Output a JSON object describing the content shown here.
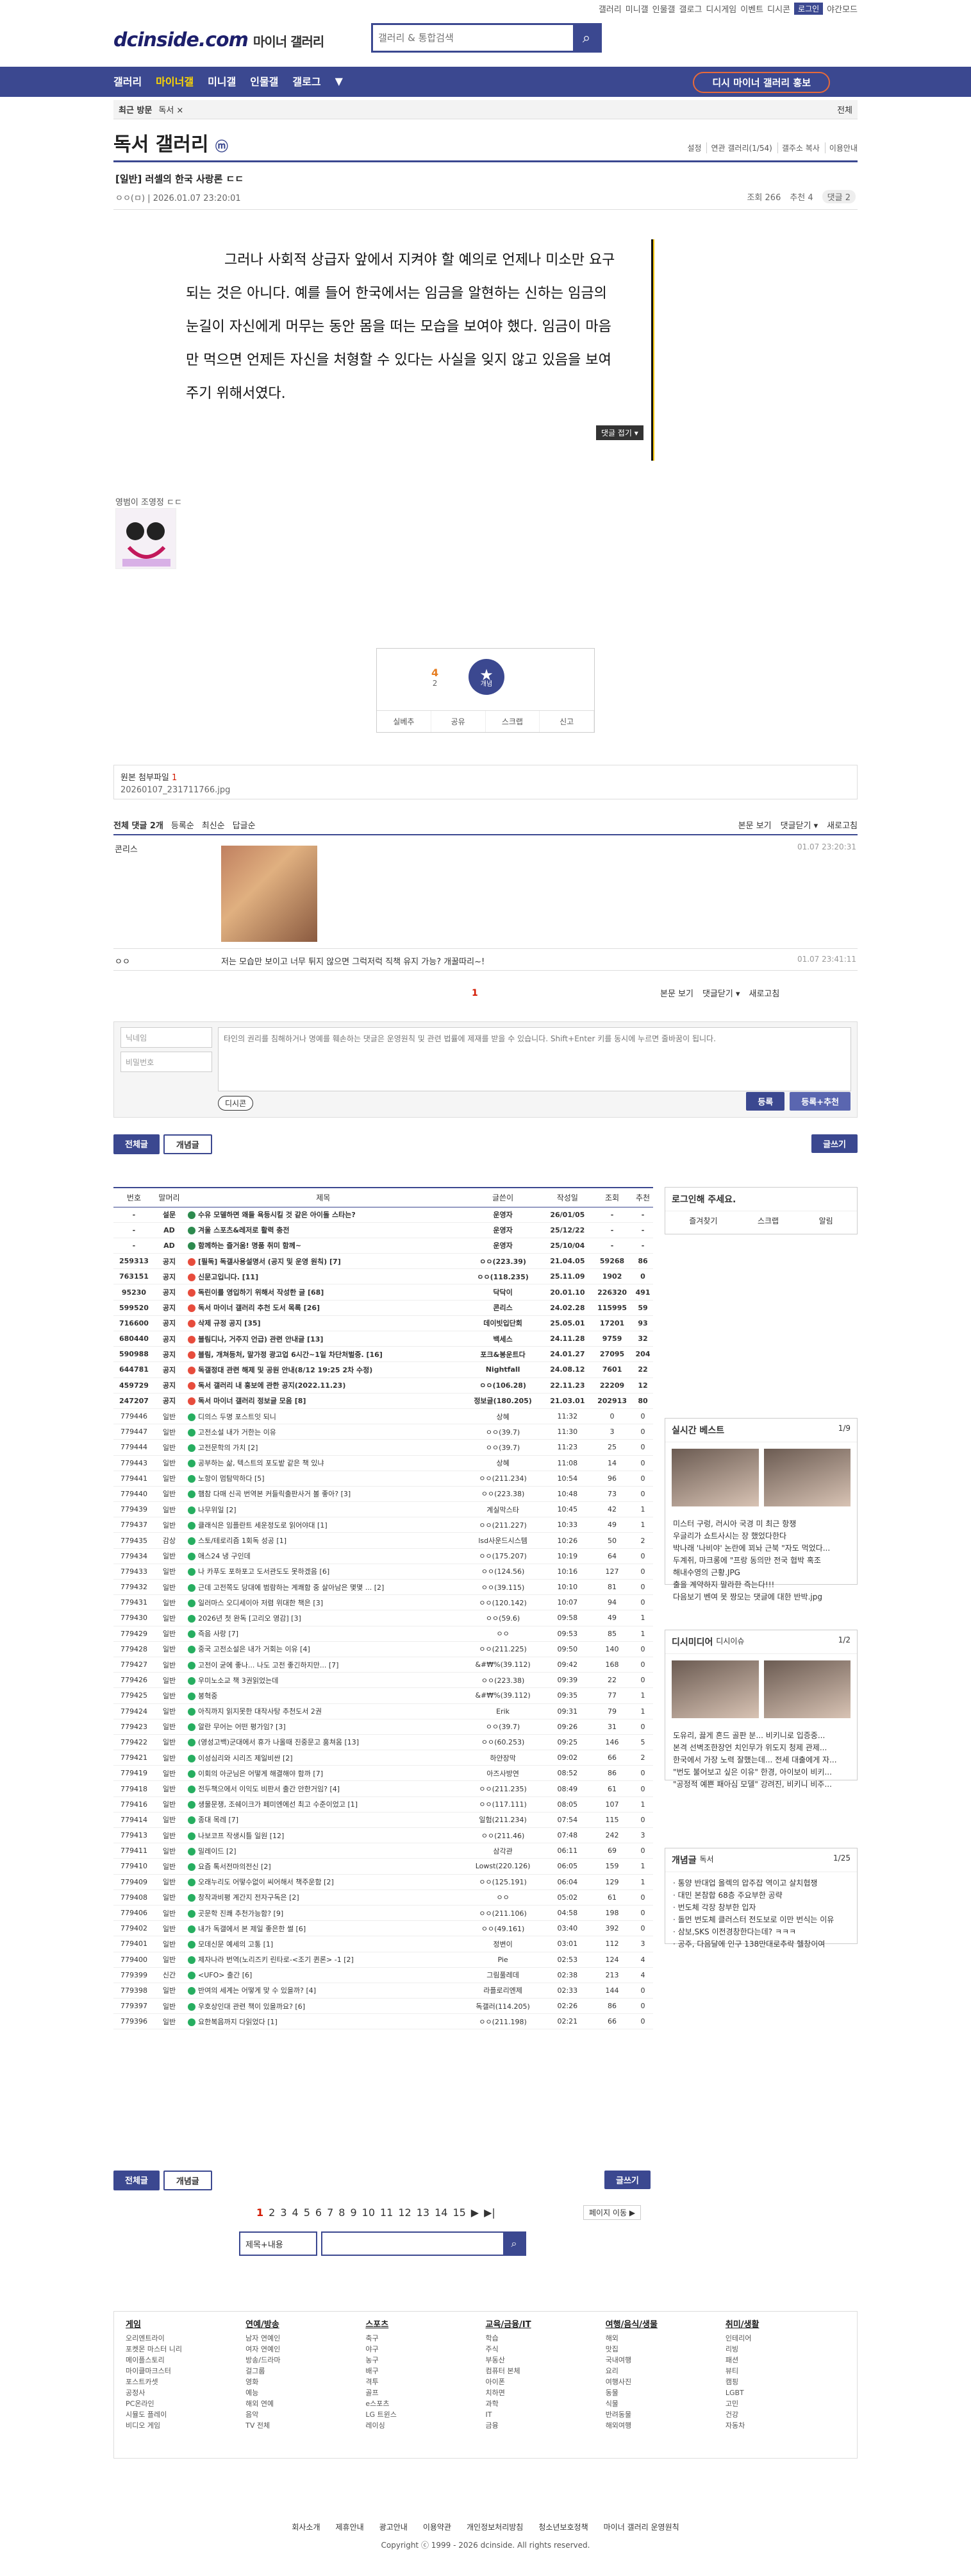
{
  "util": {
    "links": [
      "갤러리",
      "미니갤",
      "인물갤",
      "갤로그",
      "디시게임",
      "이벤트",
      "디시콘"
    ],
    "login": "로그인",
    "night": "야간모드"
  },
  "logo": {
    "brand": "dcinside.com",
    "sub": "마이너 갤러리"
  },
  "search": {
    "placeholder": "갤러리 & 통합검색"
  },
  "gnb": {
    "items": [
      "갤러리",
      "마이너갤",
      "미니갤",
      "인물갤",
      "갤로그",
      "▼"
    ],
    "cta": "디시 마이너 갤러리 홍보"
  },
  "crumb": {
    "left": "최근 방문",
    "center": "독서 ×",
    "right": "전체"
  },
  "gallery": {
    "title": "독서 갤러리",
    "mark": "ⓜ",
    "opts": [
      "설정",
      "연관 갤러리(1/54)",
      "갤주소 복사",
      "이용안내"
    ]
  },
  "post": {
    "title": "[일반] 러셀의 한국 사랑론 ㄷㄷ",
    "author": "ㅇㅇ(ㅁ)",
    "date": "2026.01.07 23:20:01",
    "views": "조회 266",
    "recs": "추천 4",
    "cmts": "댓글 2",
    "body": "그러나 사회적 상급자 앞에서 지켜야 할 예의로 언제나 미소만 요구되는 것은 아니다. 예를 들어 한국에서는 임금을 알현하는 신하는 임금의 눈길이 자신에게 머무는 동안 몸을 떠는 모습을 보여야 했다. 임금이 마음만 먹으면 언제든 자신을 처형할 수 있다는 사실을 잊지 않고 있음을 보여주기 위해서였다.",
    "fold": "댓글 접기 ▾",
    "sig": "영범이 조영정 ㄷㄷ"
  },
  "rec": {
    "up": "4",
    "upsub": "2",
    "star": "★",
    "starlbl": "개념",
    "btns": [
      "실베추",
      "공유",
      "스크랩",
      "신고"
    ]
  },
  "attach": {
    "label": "원본 첨부파일",
    "count": "1",
    "file": "20260107_231711766.jpg"
  },
  "cmthead": {
    "total": "전체 댓글 2개",
    "opts": [
      "등록순",
      "최신순",
      "답글순"
    ],
    "r": [
      "본문 보기",
      "댓글닫기 ▾",
      "새로고침"
    ]
  },
  "comments": [
    {
      "name": "콘리스",
      "time": "01.07 23:20:31",
      "text": ""
    },
    {
      "name": "ㅇㅇ",
      "time": "01.07 23:41:11",
      "text": "저는 모습만 보이고 너무 튀지 않으면 그럭저럭 직책 유지 가능? 개꿀따리~!"
    }
  ],
  "write": {
    "nick": "닉네임",
    "pw": "비밀번호",
    "ph": "타인의 권리를 침해하거나 명예를 훼손하는 댓글은 운영원칙 및 관련 법률에 제재를 받을 수 있습니다. Shift+Enter 키를 동시에 누르면 줄바꿈이 됩니다.",
    "dcon": "디시콘",
    "reg": "등록",
    "reg2": "등록+추천"
  },
  "tabs": {
    "all": "전체글",
    "best": "개념글",
    "write": "글쓰기"
  },
  "listHead": [
    "번호",
    "말머리",
    "제목",
    "글쓴이",
    "작성일",
    "조회",
    "추천"
  ],
  "rows": [
    [
      "-",
      "설문",
      "수유 모델하면 왜들 욕등시킬 것 같은 아이돌 스타는?",
      "운영자",
      "26/01/05",
      "-",
      "-",
      "n"
    ],
    [
      "-",
      "AD",
      "겨울 스포츠&레저로 활력 충전",
      "운영자",
      "25/12/22",
      "-",
      "-",
      "n"
    ],
    [
      "-",
      "AD",
      "함께하는 즐거움! 명품 취미 함께~",
      "운영자",
      "25/10/04",
      "-",
      "-",
      "n"
    ],
    [
      "259313",
      "공지",
      "[필독] 독갤사용설명서 (공지 및 운영 원칙) [7]",
      "ㅇㅇ(223.39)",
      "21.04.05",
      "59268",
      "86",
      "n"
    ],
    [
      "763151",
      "공지",
      "신문고입니다. [11]",
      "ㅇㅇ(118.235)",
      "25.11.09",
      "1902",
      "0",
      "n"
    ],
    [
      "95230",
      "공지",
      "독린이를 영입하기 위해서 작성한 글 [68]",
      "닥닥이",
      "20.01.10",
      "226320",
      "491",
      "n"
    ],
    [
      "599520",
      "공지",
      "독서 마이너 갤러리 추천 도서 목록 [26]",
      "콘리스",
      "24.02.28",
      "115995",
      "59",
      "n"
    ],
    [
      "716600",
      "공지",
      "삭제 규정 공지 [35]",
      "데이빗입단회",
      "25.05.01",
      "17201",
      "93",
      "n"
    ],
    [
      "680440",
      "공지",
      "블림디나, 거주지 언급) 관련 안내글 [13]",
      "백세스",
      "24.11.28",
      "9759",
      "32",
      "n"
    ],
    [
      "590988",
      "공지",
      "블림, 개쳐등처, 말가정 광고업 6시간~1일 차단처벌중. [16]",
      "포크&봉운트다",
      "24.01.27",
      "27095",
      "204",
      "n"
    ],
    [
      "644781",
      "공지",
      "독갤정대 관련 해제 및 공원 안내(8/12 19:25 2차 수정)",
      "Nightfall",
      "24.08.12",
      "7601",
      "22",
      "n"
    ],
    [
      "459729",
      "공지",
      "독서 갤러리 내 홍보에 관한 공지(2022.11.23)",
      "ㅇㅇ(106.28)",
      "22.11.23",
      "22209",
      "12",
      "n"
    ],
    [
      "247207",
      "공지",
      "독서 마이너 갤러리 정보글 모음 [8]",
      "정보글(180.205)",
      "21.03.01",
      "202913",
      "80",
      "n"
    ],
    [
      "779446",
      "일반",
      "디의스 두명 포스트잇 되니",
      "상혜",
      "11:32",
      "0",
      "0",
      ""
    ],
    [
      "779447",
      "일반",
      "고전소설 내가 거한는 이유",
      "ㅇㅇ(39.7)",
      "11:30",
      "3",
      "0",
      ""
    ],
    [
      "779444",
      "일반",
      "고전문학의 가치 [2]",
      "ㅇㅇ(39.7)",
      "11:23",
      "25",
      "0",
      ""
    ],
    [
      "779443",
      "일반",
      "공부하는 삶, 텍스트의 포도밭 같은 책 있냐",
      "상혜",
      "11:08",
      "14",
      "0",
      ""
    ],
    [
      "779441",
      "일반",
      "노항이 멈탐막하다 [5]",
      "ㅇㅇ(211.234)",
      "10:54",
      "96",
      "0",
      ""
    ],
    [
      "779440",
      "일반",
      "햄참 다매 신곡 번역본 커들릭출판사거 볼 좋아? [3]",
      "ㅇㅇ(223.38)",
      "10:48",
      "73",
      "0",
      ""
    ],
    [
      "779439",
      "일반",
      "나무위일 [2]",
      "계실막스타",
      "10:45",
      "42",
      "1",
      ""
    ],
    [
      "779437",
      "일반",
      "클래식은 임플란트 세운정도로 읽어야대 [1]",
      "ㅇㅇ(211.227)",
      "10:33",
      "49",
      "1",
      ""
    ],
    [
      "779435",
      "감상",
      "스토/테로리즘 1회독 성공 [1]",
      "lsd사운드시스템",
      "10:26",
      "50",
      "2",
      ""
    ],
    [
      "779434",
      "일반",
      "애스24 냉 구인데",
      "ㅇㅇ(175.207)",
      "10:19",
      "64",
      "0",
      ""
    ],
    [
      "779433",
      "일반",
      "나 카푸도 포하포고 도서관도도 못하겠음 [6]",
      "ㅇㅇ(124.56)",
      "10:16",
      "127",
      "0",
      ""
    ],
    [
      "779432",
      "일반",
      "근데 고전쪽도 당대에 범람하는 계쾌함 중 살아남은 몇몇 ... [2]",
      "ㅇㅇ(39.115)",
      "10:10",
      "81",
      "0",
      ""
    ],
    [
      "779431",
      "일반",
      "일러마스 오디세이아 저렴 위대한 책은 [3]",
      "ㅇㅇ(120.142)",
      "10:07",
      "94",
      "0",
      ""
    ],
    [
      "779430",
      "일반",
      "2026년 첫 완독 [고리오 영감] [3]",
      "ㅇㅇ(59.6)",
      "09:58",
      "49",
      "1",
      ""
    ],
    [
      "779429",
      "일반",
      "즉음 사랑 [7]",
      "ㅇㅇ",
      "09:53",
      "85",
      "1",
      ""
    ],
    [
      "779428",
      "일반",
      "중국 고전소설은 내가 거회는 이유 [4]",
      "ㅇㅇ(211.225)",
      "09:50",
      "140",
      "0",
      ""
    ],
    [
      "779427",
      "일반",
      "고전이 굳에 좋나... 나도 고전 좋긴하지만... [7]",
      "&#₩%(39.112)",
      "09:42",
      "168",
      "0",
      ""
    ],
    [
      "779426",
      "일반",
      "우미노소교 책 3권읽었는데",
      "ㅇㅇ(223.38)",
      "09:39",
      "22",
      "0",
      ""
    ],
    [
      "779425",
      "일반",
      "봉혁중",
      "&#₩%(39.112)",
      "09:35",
      "77",
      "1",
      ""
    ],
    [
      "779424",
      "일반",
      "아직까지 읽지못한 대작사탕 추천도서 2권",
      "Erik",
      "09:31",
      "79",
      "1",
      ""
    ],
    [
      "779423",
      "일반",
      "알란 무어는 어떤 평가임? [3]",
      "ㅇㅇ(39.7)",
      "09:26",
      "31",
      "0",
      ""
    ],
    [
      "779422",
      "일반",
      "(영성고백)군대에서 휴가 나올때 진중문고 훔쳐옴 [13]",
      "ㅇㅇ(60.253)",
      "09:25",
      "146",
      "5",
      ""
    ],
    [
      "779421",
      "일반",
      "이성심리와 시리즈 제일비싼 [2]",
      "하얀장막",
      "09:02",
      "66",
      "2",
      ""
    ],
    [
      "779419",
      "일반",
      "이회의 아군님은 어떻게 해결해야 함까 [7]",
      "아즈사방연",
      "08:52",
      "86",
      "0",
      ""
    ],
    [
      "779418",
      "일반",
      "전두책으에서 이익도 비판서 출간 안한거임? [4]",
      "ㅇㅇ(211.235)",
      "08:49",
      "61",
      "0",
      ""
    ],
    [
      "779416",
      "일반",
      "생물문쟁, 조쉐이크가 페미엔에선 최고 수준이었고 [1]",
      "ㅇㅇ(117.111)",
      "08:05",
      "107",
      "1",
      ""
    ],
    [
      "779414",
      "일반",
      "종대 목레 [7]",
      "일험(211.234)",
      "07:54",
      "115",
      "0",
      ""
    ],
    [
      "779413",
      "일반",
      "나보코프 작생시틀 일원 [12]",
      "ㅇㅇ(211.46)",
      "07:48",
      "242",
      "3",
      ""
    ],
    [
      "779411",
      "일반",
      "밀레이드 [2]",
      "삼각관",
      "06:11",
      "69",
      "0",
      ""
    ],
    [
      "779410",
      "일반",
      "요즘 톡서전마의전신 [2]",
      "Lowst(220.126)",
      "06:05",
      "159",
      "1",
      ""
    ],
    [
      "779409",
      "일반",
      "오래누리도 어떻수없이 씨어해서 책주운함 [2]",
      "ㅇㅇ(125.191)",
      "06:04",
      "129",
      "1",
      ""
    ],
    [
      "779408",
      "일반",
      "창작과비평 계간지 전자구독은 [2]",
      "ㅇㅇ",
      "05:02",
      "61",
      "0",
      ""
    ],
    [
      "779406",
      "일반",
      "곳문학 진쾌 추천가능함? [9]",
      "ㅇㅇ(211.106)",
      "04:58",
      "198",
      "0",
      ""
    ],
    [
      "779402",
      "일반",
      "내가 독갤에서 본 제일 좋은한 썰 [6]",
      "ㅇㅇ(49.161)",
      "03:40",
      "392",
      "0",
      ""
    ],
    [
      "779401",
      "일반",
      "모데신문 예세의 고통 [1]",
      "정변이",
      "03:01",
      "112",
      "3",
      ""
    ],
    [
      "779400",
      "일반",
      "제자나라 번역(노리즈키 린타로-<조기 퀸론> -1 [2]",
      "Pie",
      "02:53",
      "124",
      "4",
      ""
    ],
    [
      "779399",
      "신간",
      "<UFO> 출간 [6]",
      "그림풀레데",
      "02:38",
      "213",
      "4",
      ""
    ],
    [
      "779398",
      "일반",
      "반여의 세계는 어떻게 맞 수 있을까? [4]",
      "라플로리엔제",
      "02:33",
      "144",
      "0",
      ""
    ],
    [
      "779397",
      "일반",
      "우호상인대 관련 책이 있을까요? [6]",
      "독갤러(114.205)",
      "02:26",
      "86",
      "0",
      ""
    ],
    [
      "779396",
      "일반",
      "요한복음까지 다읽었다 [1]",
      "ㅇㅇ(211.198)",
      "02:21",
      "66",
      "0",
      ""
    ]
  ],
  "side": {
    "login": "로그인해 주세요.",
    "loginBtns": [
      "즐겨찾기",
      "스크랩",
      "알림"
    ],
    "real": {
      "title": "실시간 베스트",
      "page": "1/9",
      "items": [
        "미스터 구렁, 러시아 국경 미 최근 항쟁",
        "우글리가 쇼트사시는 장 했었다한다",
        "박나래 '나비야' 논란에 꾀놔 근북 \"자도 먹었다...",
        "두계쥐, 마크롱에 \"프랑 동의만 전국 협박 혹조",
        "해내수영의 근황.JPG",
        "출을 계약하지 말라한 즉는다!!!",
        "다음보기 벤여 못 짱모는 댓글에 대한 반박.jpg"
      ]
    },
    "media": {
      "title": "디시미디어",
      "sub": "디시이슈",
      "page": "1/2",
      "items": [
        "도유리, 끓게 흔드 골판 분... 비키니로 입증중...",
        "본격 선벽조한장언 치인무가 위도지 청제 관제...",
        "한국에서 가장 노력 잘했는데... 전세 대출에게 자...",
        "\"번도 불어보고 싶은 이유\" 한경, 아이보이 비키...",
        "\"공정적 예쁜 패아심 모델\" 강려진, 비키니 비주..."
      ]
    },
    "best": {
      "title": "개념글",
      "sub": "독서",
      "page": "1/25",
      "items": [
        "통양 반대업 올렉의 압주잡 역이고 살치협쟁",
        "대민 본참합 68층 주요부한 공략",
        "번도체 각장 창부한 입자",
        "돌먼 번도체 클러스터 전도보로 이만 번식는 이유",
        "삼보,SKS 이전경창한다는데? ㅋㅋㅋ",
        "공주, 다음달에 인구 138만대로추락 헬창이여"
      ]
    }
  },
  "pager": {
    "pages": [
      "1",
      "2",
      "3",
      "4",
      "5",
      "6",
      "7",
      "8",
      "9",
      "10",
      "11",
      "12",
      "13",
      "14",
      "15",
      "▶",
      "▶|"
    ]
  },
  "searchBot": {
    "select": "제목+내용",
    "move": "페이지 이동 ▶"
  },
  "footer": {
    "cols": [
      {
        "h": "게임",
        "items": [
          "오리엔트라이",
          "포켓몬 마스터 니리",
          "메이플스토리",
          "마이클마크스터",
          "포스트카셋",
          "공정사",
          "PC온라인",
          "시뮬도 플레이",
          "비디오 게임"
        ]
      },
      {
        "h": "연예/방송",
        "items": [
          "남자 연예인",
          "여자 연예인",
          "방송/드라마",
          "걸그룹",
          "영화",
          "예능",
          "해외 연예",
          "음악",
          "TV 전체"
        ]
      },
      {
        "h": "스포츠",
        "items": [
          "축구",
          "야구",
          "농구",
          "배구",
          "격투",
          "골프",
          "e스포츠",
          "LG 트윈스",
          "레이싱"
        ]
      },
      {
        "h": "교육/금융/IT",
        "items": [
          "학습",
          "주식",
          "부동산",
          "컴퓨터 본체",
          "아이폰",
          "치하면",
          "과학",
          "IT",
          "금융"
        ]
      },
      {
        "h": "여행/음식/생물",
        "items": [
          "해외",
          "맛집",
          "국내여행",
          "요리",
          "여행사진",
          "동물",
          "식물",
          "반려동물",
          "해외여행"
        ]
      },
      {
        "h": "취미/생활",
        "items": [
          "인테리어",
          "리빙",
          "패션",
          "뷰티",
          "캠핑",
          "LGBT",
          "고민",
          "건강",
          "자동차"
        ]
      }
    ]
  },
  "foot": {
    "links": [
      "회사소개",
      "제휴안내",
      "광고안내",
      "이용약관",
      "개인정보처리방침",
      "청소년보호정책",
      "마이너 갤러리 운영원칙"
    ],
    "copy": "Copyright ⓒ 1999 - 2026 dcinside. All rights reserved."
  }
}
